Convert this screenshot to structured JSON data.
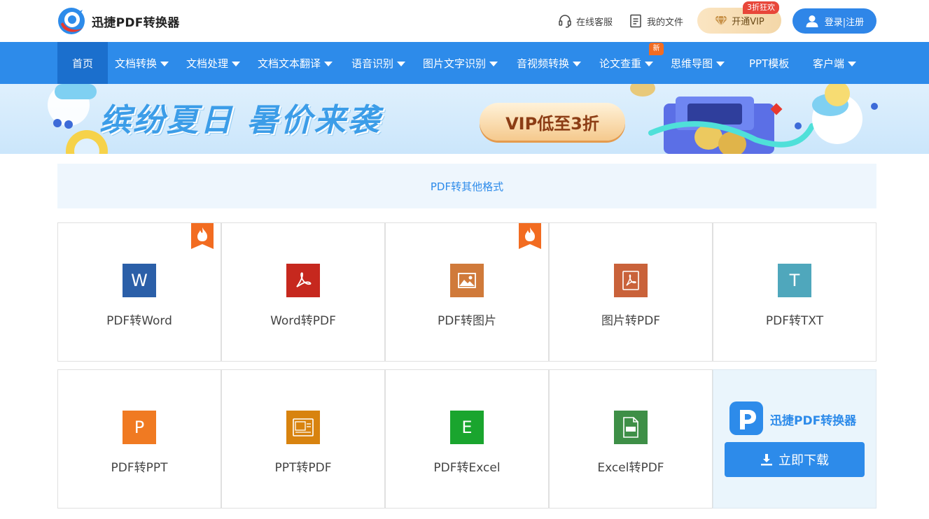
{
  "header": {
    "brand": "迅捷PDF转换器",
    "service_label": "在线客服",
    "files_label": "我的文件",
    "vip_label": "开通VIP",
    "vip_badge": "3折狂欢",
    "login_label": "登录|注册"
  },
  "nav": {
    "items": [
      {
        "label": "首页",
        "dropdown": false
      },
      {
        "label": "文档转换",
        "dropdown": true
      },
      {
        "label": "文档处理",
        "dropdown": true
      },
      {
        "label": "文档文本翻译",
        "dropdown": true
      },
      {
        "label": "语音识别",
        "dropdown": true
      },
      {
        "label": "图片文字识别",
        "dropdown": true
      },
      {
        "label": "音视频转换",
        "dropdown": true
      },
      {
        "label": "论文查重",
        "dropdown": true
      },
      {
        "label": "思维导图",
        "dropdown": true
      },
      {
        "label": "PPT模板",
        "dropdown": false
      },
      {
        "label": "客户端",
        "dropdown": true
      }
    ],
    "new_badge": "新"
  },
  "banner": {
    "headline": "缤纷夏日 暑价来袭",
    "pill": "VIP低至3折"
  },
  "category": {
    "title": "PDF转其他格式"
  },
  "tools": [
    {
      "label": "PDF转Word",
      "icon": "word-icon",
      "glyph": "W",
      "color": "#2b5fa8",
      "hot": true
    },
    {
      "label": "Word转PDF",
      "icon": "pdf-icon",
      "glyph": "",
      "color": "#c6281e",
      "hot": false
    },
    {
      "label": "PDF转图片",
      "icon": "image-icon",
      "glyph": "",
      "color": "#d07a3a",
      "hot": true
    },
    {
      "label": "图片转PDF",
      "icon": "pdf-icon",
      "glyph": "",
      "color": "#c9623a",
      "hot": false
    },
    {
      "label": "PDF转TXT",
      "icon": "txt-icon",
      "glyph": "T",
      "color": "#4fa7bc",
      "hot": false
    },
    {
      "label": "PDF转PPT",
      "icon": "ppt-icon",
      "glyph": "P",
      "color": "#f07a22",
      "hot": false
    },
    {
      "label": "PPT转PDF",
      "icon": "ppt-pdf-icon",
      "glyph": "",
      "color": "#d8830f",
      "hot": false
    },
    {
      "label": "PDF转Excel",
      "icon": "excel-icon",
      "glyph": "E",
      "color": "#1aa52e",
      "hot": false
    },
    {
      "label": "Excel转PDF",
      "icon": "excel-pdf-icon",
      "glyph": "",
      "color": "#3e8f47",
      "hot": false
    }
  ],
  "download": {
    "app_name": "迅捷PDF转换器",
    "button_label": "立即下载"
  },
  "colors": {
    "nav_bg": "#2d8bea",
    "nav_active": "#1b6fcd",
    "accent": "#2d8bea",
    "hot": "#f26c21"
  }
}
